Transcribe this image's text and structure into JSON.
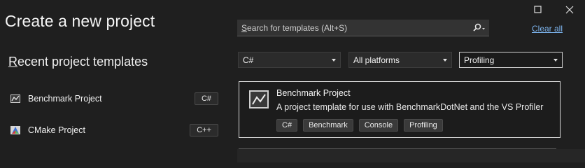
{
  "window": {
    "title": "Create a new project",
    "maximize_icon": "maximize-icon",
    "close_icon": "close-icon"
  },
  "recent": {
    "heading_underlined": "R",
    "heading_rest": "ecent project templates",
    "items": [
      {
        "name": "Benchmark Project",
        "language": "C#",
        "icon": "benchmark-chart-icon"
      },
      {
        "name": "CMake Project",
        "language": "C++",
        "icon": "cmake-icon"
      }
    ]
  },
  "search": {
    "placeholder_underlined": "S",
    "placeholder_rest": "earch for templates (Alt+S)",
    "icon": "search-icon",
    "clear_all": "Clear all"
  },
  "filters": {
    "language": "C#",
    "platform": "All platforms",
    "project_type": "Profiling"
  },
  "results": [
    {
      "name": "Benchmark Project",
      "description": "A project template for use with BenchmarkDotNet and the VS Profiler",
      "tags": [
        "C#",
        "Benchmark",
        "Console",
        "Profiling"
      ],
      "icon": "benchmark-chart-icon"
    }
  ],
  "colors": {
    "background": "#1f1f1f",
    "link": "#7db5ef",
    "selected_border": "#d8d8d8"
  }
}
